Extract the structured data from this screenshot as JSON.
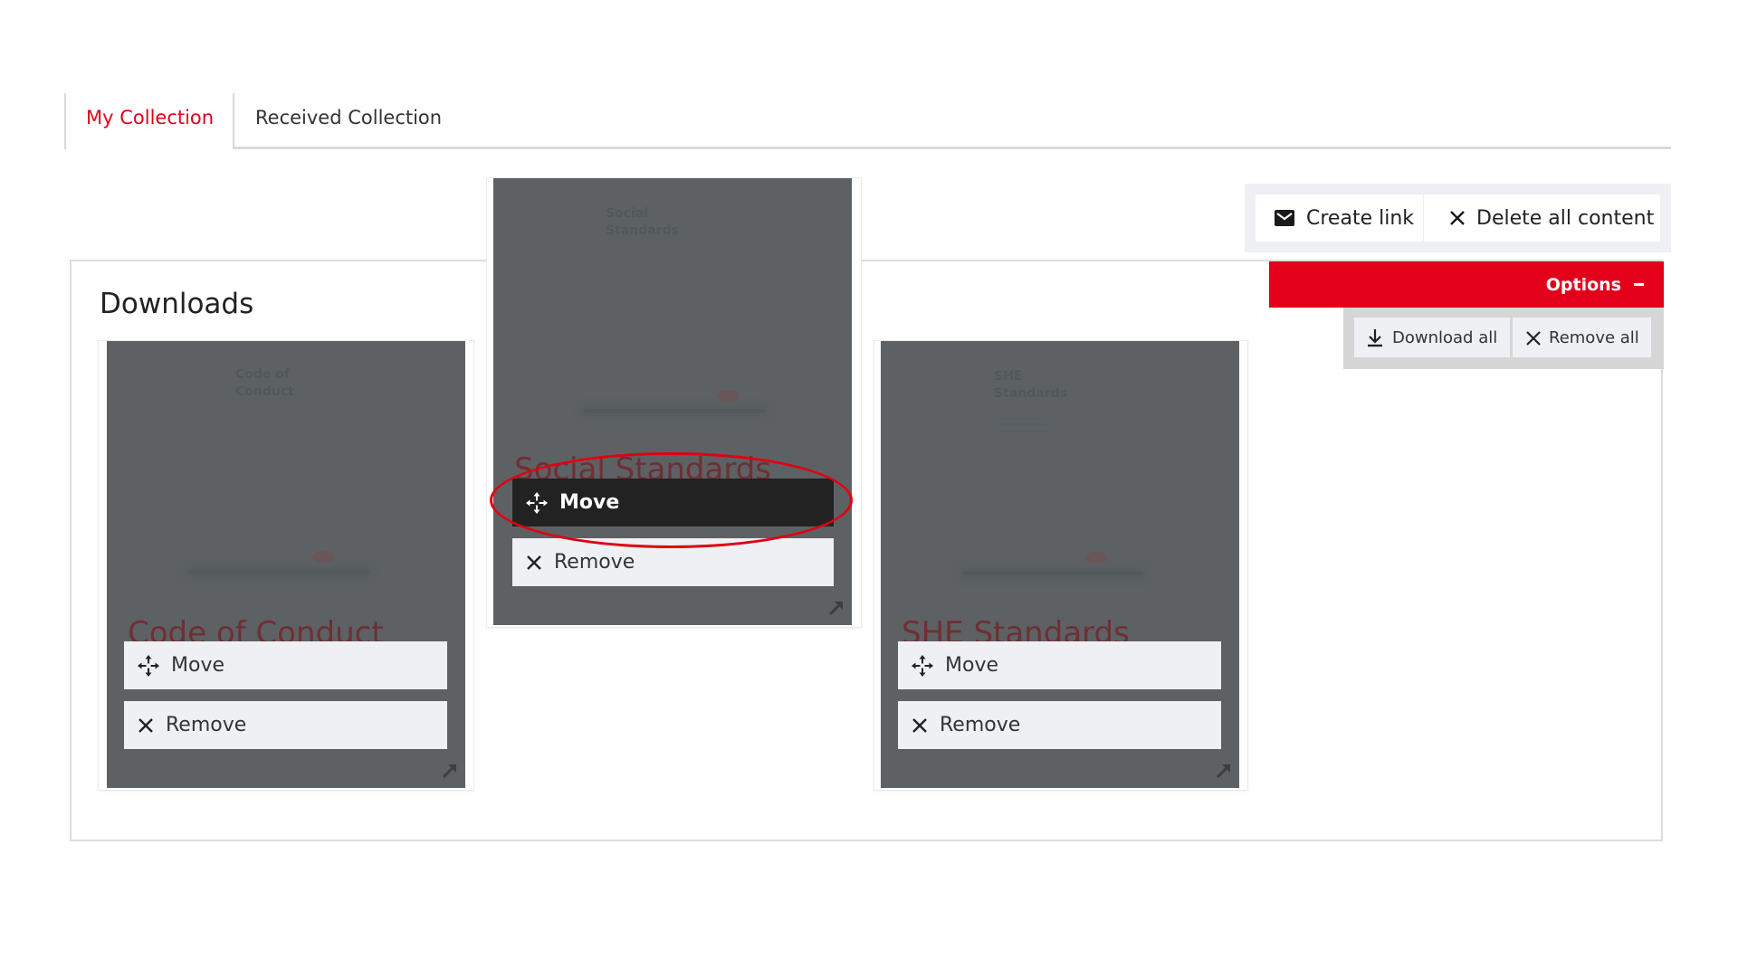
{
  "tabs": [
    {
      "label": "My Collection",
      "active": true
    },
    {
      "label": "Received Collection",
      "active": false
    }
  ],
  "actions": {
    "create_link": {
      "label": "Create link",
      "icon": "envelope-icon"
    },
    "delete_all": {
      "label": "Delete all content",
      "icon": "close-icon"
    }
  },
  "panel": {
    "title": "Downloads"
  },
  "options": {
    "label": "Options",
    "state_icon": "minus-icon",
    "download_all": {
      "label": "Download all",
      "icon": "download-icon"
    },
    "remove_all": {
      "label": "Remove all",
      "icon": "close-icon"
    }
  },
  "cards": [
    {
      "cover_title_small": [
        "Code of",
        "Conduct"
      ],
      "title": "Code of Conduct",
      "move_label": "Move",
      "remove_label": "Remove",
      "state": "default"
    },
    {
      "cover_title_small": [
        "Social",
        "Standards"
      ],
      "title": "Social Standards",
      "move_label": "Move",
      "remove_label": "Remove",
      "state": "dragging",
      "move_highlighted": true
    },
    {
      "cover_title_small": [
        "SHE",
        "Standards"
      ],
      "title": "SHE Standards",
      "move_label": "Move",
      "remove_label": "Remove",
      "state": "default"
    }
  ],
  "colors": {
    "brand_red": "#e2001a",
    "card_overlay": "#5d6164",
    "move_active": "#222222",
    "annotation_ellipse": "#e00010"
  }
}
